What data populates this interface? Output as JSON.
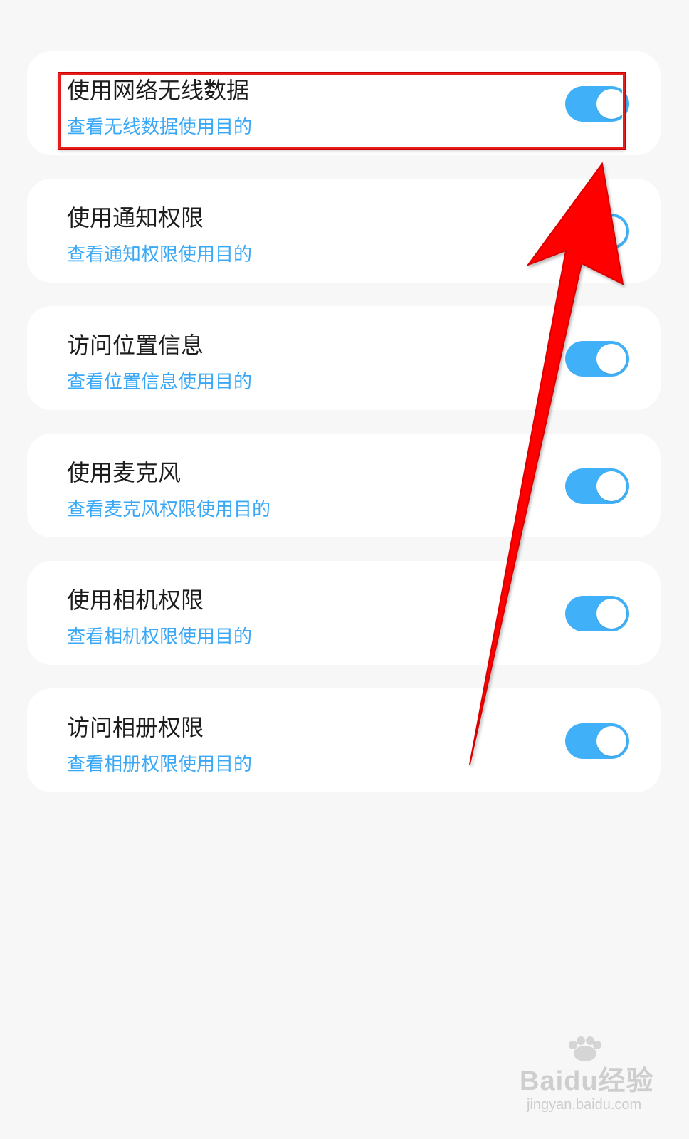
{
  "permissions": [
    {
      "title": "使用网络无线数据",
      "subtitle": "查看无线数据使用目的",
      "enabled": true,
      "toggle_icon": "toggle-on-icon"
    },
    {
      "title": "使用通知权限",
      "subtitle": "查看通知权限使用目的",
      "enabled": true,
      "toggle_icon": "toggle-on-icon"
    },
    {
      "title": "访问位置信息",
      "subtitle": "查看位置信息使用目的",
      "enabled": true,
      "toggle_icon": "toggle-on-icon"
    },
    {
      "title": "使用麦克风",
      "subtitle": "查看麦克风权限使用目的",
      "enabled": true,
      "toggle_icon": "toggle-on-icon"
    },
    {
      "title": "使用相机权限",
      "subtitle": "查看相机权限使用目的",
      "enabled": true,
      "toggle_icon": "toggle-on-icon"
    },
    {
      "title": "访问相册权限",
      "subtitle": "查看相册权限使用目的",
      "enabled": true,
      "toggle_icon": "toggle-on-icon"
    }
  ],
  "annotations": {
    "highlight_color": "#e51d1d",
    "arrow_color": "#ff0000",
    "arrow_icon": "red-arrow-icon"
  },
  "colors": {
    "page_background": "#f7f7f7",
    "card_background": "#ffffff",
    "title_text": "#1d1d1d",
    "subtitle_text": "#3aa8f6",
    "toggle_on": "#40b1f8"
  },
  "watermark": {
    "brand": "Baidu经验",
    "url": "jingyan.baidu.com",
    "icon": "baidu-paw-icon"
  }
}
